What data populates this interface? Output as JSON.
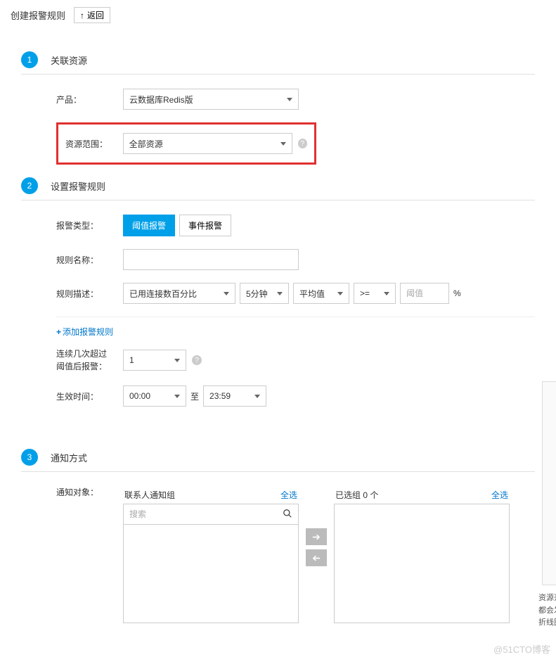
{
  "header": {
    "title": "创建报警规则",
    "back": "返回"
  },
  "step1": {
    "num": "1",
    "title": "关联资源",
    "product_label": "产品：",
    "product_value": "云数据库Redis版",
    "scope_label": "资源范围：",
    "scope_value": "全部资源"
  },
  "step2": {
    "num": "2",
    "title": "设置报警规则",
    "alarm_type_label": "报警类型：",
    "tab_threshold": "阈值报警",
    "tab_event": "事件报警",
    "rule_name_label": "规则名称：",
    "rule_desc_label": "规则描述：",
    "metric": "已用连接数百分比",
    "duration": "5分钟",
    "stat": "平均值",
    "op": ">=",
    "threshold_placeholder": "阈值",
    "percent": "%",
    "add_rule": "添加报警规则",
    "consecutive_label_l1": "连续几次超过",
    "consecutive_label_l2": "阈值后报警：",
    "consecutive_value": "1",
    "effective_label": "生效时间：",
    "time_from": "00:00",
    "time_to": "23:59",
    "to_sep": "至"
  },
  "side_text": {
    "l1": "资源范围选",
    "l2": "都会发出报",
    "l3": "折线图展示"
  },
  "step3": {
    "num": "3",
    "title": "通知方式",
    "target_label": "通知对象：",
    "left_header": "联系人通知组",
    "right_header": "已选组 0 个",
    "select_all": "全选",
    "search_placeholder": "搜索"
  },
  "watermark": "@51CTO博客"
}
